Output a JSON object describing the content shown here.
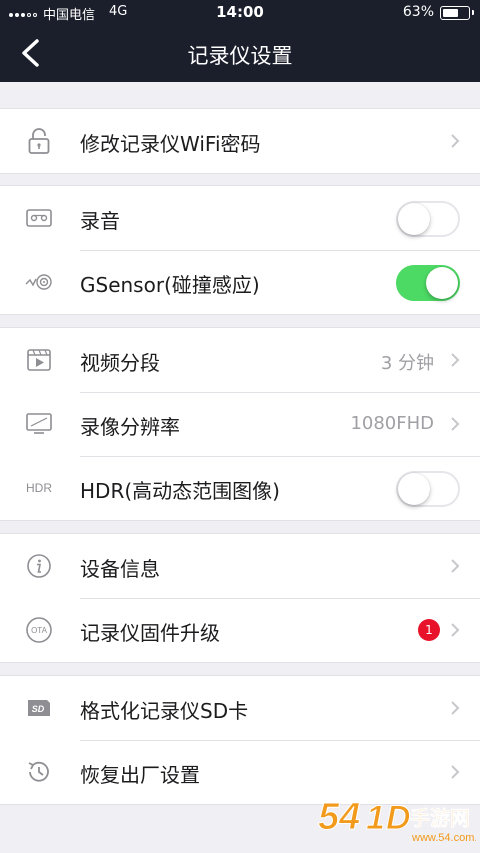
{
  "status_bar": {
    "carrier": "中国电信",
    "network": "4G",
    "time": "14:00",
    "battery_percent": "63%",
    "battery_level": 0.63
  },
  "nav": {
    "title": "记录仪设置"
  },
  "groups": [
    {
      "rows": [
        {
          "label": "修改记录仪WiFi密码",
          "icon": "lock-icon",
          "type": "link"
        }
      ]
    },
    {
      "rows": [
        {
          "label": "录音",
          "icon": "audio-icon",
          "type": "toggle",
          "on": false
        },
        {
          "label": "GSensor(碰撞感应)",
          "icon": "gsensor-icon",
          "type": "toggle",
          "on": true
        }
      ]
    },
    {
      "rows": [
        {
          "label": "视频分段",
          "value": "3 分钟",
          "icon": "video-segment-icon",
          "type": "link"
        },
        {
          "label": "录像分辨率",
          "value": "1080FHD",
          "icon": "resolution-icon",
          "type": "link"
        },
        {
          "label": "HDR(高动态范围图像)",
          "icon_text": "HDR",
          "icon": "hdr-icon",
          "type": "toggle",
          "on": false
        }
      ]
    },
    {
      "rows": [
        {
          "label": "设备信息",
          "icon": "info-icon",
          "type": "link"
        },
        {
          "label": "记录仪固件升级",
          "icon_text": "OTA",
          "icon": "ota-icon",
          "type": "link",
          "badge": "1"
        }
      ]
    },
    {
      "rows": [
        {
          "label": "格式化记录仪SD卡",
          "icon_text": "SD",
          "icon": "sd-card-icon",
          "type": "link"
        },
        {
          "label": "恢复出厂设置",
          "icon": "restore-icon",
          "type": "link"
        }
      ]
    }
  ],
  "watermark": {
    "text": "手游网",
    "url": "www.54.com.cn"
  },
  "colors": {
    "nav_bg": "#1b1e2b",
    "toggle_on": "#4cd964",
    "badge": "#e8132b",
    "page_bg": "#efeff4"
  }
}
